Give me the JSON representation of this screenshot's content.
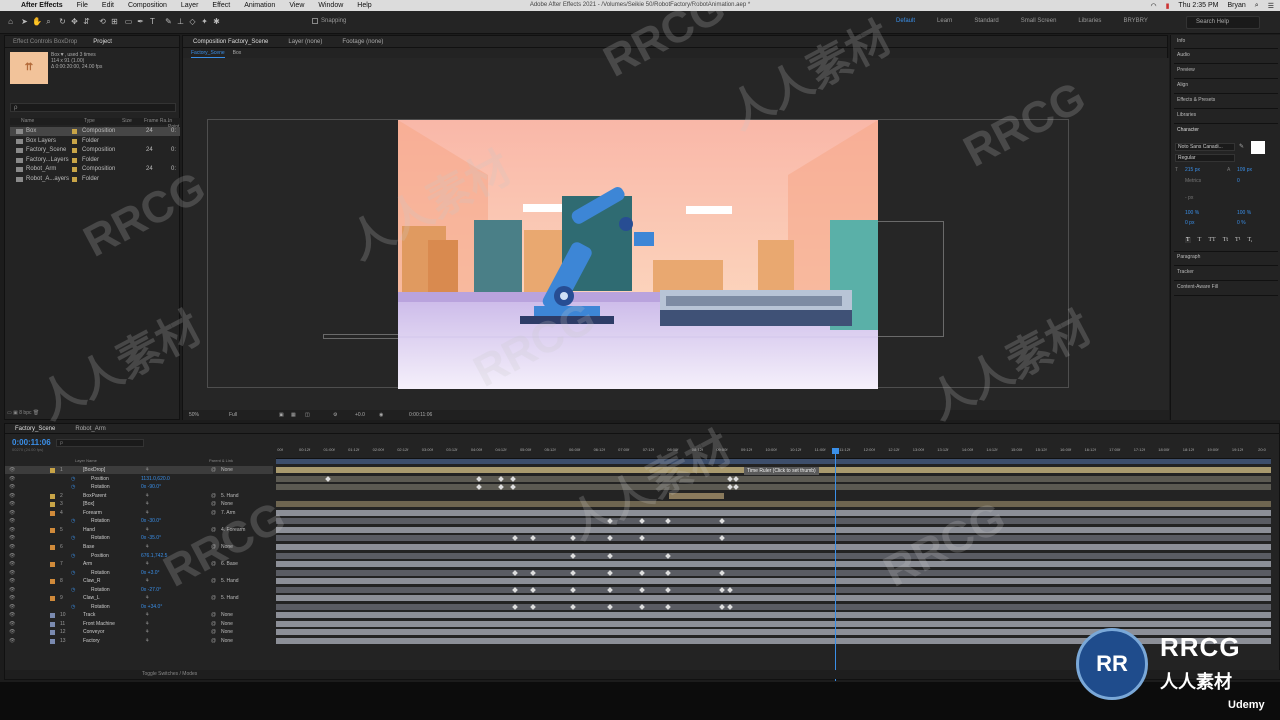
{
  "menubar": {
    "app": "After Effects",
    "items": [
      "File",
      "Edit",
      "Composition",
      "Layer",
      "Effect",
      "Animation",
      "View",
      "Window",
      "Help"
    ],
    "title": "Adobe After Effects 2021 - /Volumes/Seikie 50/RobotFactory/RobotAnimation.aep *",
    "clock": "Thu 2:35 PM",
    "user": "Bryan"
  },
  "toolbar": {
    "snapping": "Snapping",
    "workspaces": [
      "Default",
      "Learn",
      "Standard",
      "Small Screen",
      "Libraries",
      "BRYBRY"
    ],
    "search_help": "Search Help"
  },
  "project": {
    "tabs": [
      "Effect Controls BoxDrop",
      "Project"
    ],
    "thumb_name": "Box▼, used 3 times",
    "thumb_line2": "114 x 91 (1.00)",
    "thumb_line3": "Δ 0:00:20:00, 24.00 fps",
    "search_placeholder": "ρ",
    "columns": {
      "name": "Name",
      "type": "Type",
      "size": "Size",
      "fps": "Frame Ra...",
      "inpoint": "In Point"
    },
    "items": [
      {
        "name": "Box",
        "type": "Composition",
        "fps": "24",
        "in": "0:"
      },
      {
        "name": "Box Layers",
        "type": "Folder",
        "fps": "",
        "in": ""
      },
      {
        "name": "Factory_Scene",
        "type": "Composition",
        "fps": "24",
        "in": "0:"
      },
      {
        "name": "Factory...Layers",
        "type": "Folder",
        "fps": "",
        "in": ""
      },
      {
        "name": "Robot_Arm",
        "type": "Composition",
        "fps": "24",
        "in": "0:"
      },
      {
        "name": "Robot_A...ayers",
        "type": "Folder",
        "fps": "",
        "in": ""
      }
    ],
    "footer": "8 bpc"
  },
  "viewer": {
    "tabs": [
      "Composition Factory_Scene",
      "Layer (none)",
      "Footage (none)"
    ],
    "crumbs": [
      "Factory_Scene",
      "Box"
    ],
    "zoom": "50%",
    "resolution": "Full",
    "exposure": "+0.0",
    "time": "0:00:11:06"
  },
  "right": {
    "panels": [
      "Info",
      "Audio",
      "Preview",
      "Align",
      "Effects & Presets",
      "Libraries"
    ],
    "character_title": "Character",
    "font": "Noto Sans Canadi...",
    "style": "Regular",
    "size": "215 px",
    "leading": "109 px",
    "kerning": "Metrics",
    "tracking": "0",
    "stroke": "- px",
    "vscale": "100 %",
    "hscale": "100 %",
    "baseline": "0 px",
    "tsume": "0 %",
    "faux": [
      "T",
      "T",
      "TT",
      "Tt",
      "T¹",
      "T,"
    ],
    "lower_panels": [
      "Paragraph",
      "Tracker",
      "Content-Aware Fill"
    ]
  },
  "timeline": {
    "tabs": [
      "Factory_Scene",
      "Robot_Arm"
    ],
    "timecode": "0:00:11:06",
    "fps_info": "00270 (24.00 fps)",
    "search_placeholder": "ρ",
    "head": {
      "name": "Layer Name",
      "parent": "Parent & Link"
    },
    "ruler": [
      "00f",
      "00:12f",
      "01:00f",
      "01:12f",
      "02:00f",
      "02:12f",
      "03:00f",
      "03:12f",
      "04:00f",
      "04:12f",
      "05:00f",
      "05:12f",
      "06:00f",
      "06:12f",
      "07:00f",
      "07:12f",
      "08:00f",
      "08:12f",
      "09:00f",
      "09:12f",
      "10:00f",
      "10:12f",
      "11:00f",
      "11:12f",
      "12:00f",
      "12:12f",
      "13:00f",
      "13:12f",
      "14:00f",
      "14:12f",
      "15:00f",
      "15:12f",
      "16:00f",
      "16:12f",
      "17:00f",
      "17:12f",
      "18:00f",
      "18:12f",
      "19:00f",
      "19:12f",
      "20:0"
    ],
    "tooltip": "Time Ruler (Click to set thumb)",
    "rows": [
      {
        "kind": "layer",
        "idx": "1",
        "name": "[BoxDrop]",
        "parent": "None",
        "color": "#c8a447",
        "bar": [
          0,
          100
        ],
        "barColor": "#a99a6e",
        "keys": []
      },
      {
        "kind": "prop",
        "name": "Position",
        "value": "1131.0,620.0",
        "bar": [
          0,
          100
        ],
        "barColor": "#5c5a52",
        "keys": [
          5,
          20.2,
          22.4,
          23.6,
          45.4,
          46
        ]
      },
      {
        "kind": "prop",
        "name": "Rotation",
        "value": "0x -90.0°",
        "bar": [
          0,
          100
        ],
        "barColor": "#5c5a52",
        "keys": [
          20.2,
          22.4,
          23.6,
          45.4,
          46
        ]
      },
      {
        "kind": "layer",
        "idx": "2",
        "name": "BoxParent",
        "parent": "5. Hand",
        "color": "#c8a447",
        "bar": [
          39.5,
          45
        ],
        "barColor": "#8a7a5c",
        "keys": []
      },
      {
        "kind": "layer",
        "idx": "3",
        "name": "[Box]",
        "parent": "None",
        "color": "#c8a447",
        "bar": [
          0,
          100
        ],
        "barColor": "#6e6550",
        "keys": []
      },
      {
        "kind": "layer",
        "idx": "4",
        "name": "Forearm",
        "parent": "7. Arm",
        "color": "#d08a3a",
        "bar": [
          0,
          100
        ],
        "barColor": "#8c8f97",
        "keys": []
      },
      {
        "kind": "prop",
        "name": "Rotation",
        "value": "0x -30.0°",
        "bar": [
          0,
          100
        ],
        "barColor": "#5a5c63",
        "keys": [
          33.4,
          36.6,
          39.2,
          44.6
        ]
      },
      {
        "kind": "layer",
        "idx": "5",
        "name": "Hand",
        "parent": "4. Forearm",
        "color": "#d08a3a",
        "bar": [
          0,
          100
        ],
        "barColor": "#8c8f97",
        "keys": []
      },
      {
        "kind": "prop",
        "name": "Rotation",
        "value": "0x -35.0°",
        "bar": [
          0,
          100
        ],
        "barColor": "#5a5c63",
        "keys": [
          23.8,
          25.6,
          29.6,
          33.4,
          36.6,
          44.6
        ]
      },
      {
        "kind": "layer",
        "idx": "6",
        "name": "Base",
        "parent": "None",
        "color": "#d08a3a",
        "bar": [
          0,
          100
        ],
        "barColor": "#8c8f97",
        "keys": []
      },
      {
        "kind": "prop",
        "name": "Position",
        "value": "676.1,742.5",
        "bar": [
          0,
          100
        ],
        "barColor": "#5a5c63",
        "keys": [
          29.6,
          33.4,
          39.2
        ]
      },
      {
        "kind": "layer",
        "idx": "7",
        "name": "Arm",
        "parent": "6. Base",
        "color": "#d08a3a",
        "bar": [
          0,
          100
        ],
        "barColor": "#8c8f97",
        "keys": []
      },
      {
        "kind": "prop",
        "name": "Rotation",
        "value": "0x +3.0°",
        "bar": [
          0,
          100
        ],
        "barColor": "#5a5c63",
        "keys": [
          23.8,
          25.6,
          29.6,
          33.4,
          36.6,
          39.2,
          44.6
        ]
      },
      {
        "kind": "layer",
        "idx": "8",
        "name": "Claw_R",
        "parent": "5. Hand",
        "color": "#d08a3a",
        "bar": [
          0,
          100
        ],
        "barColor": "#8c8f97",
        "keys": []
      },
      {
        "kind": "prop",
        "name": "Rotation",
        "value": "0x -27.0°",
        "bar": [
          0,
          100
        ],
        "barColor": "#5a5c63",
        "keys": [
          23.8,
          25.6,
          29.6,
          33.4,
          36.6,
          39.2,
          44.6,
          45.4
        ]
      },
      {
        "kind": "layer",
        "idx": "9",
        "name": "Claw_L",
        "parent": "5. Hand",
        "color": "#d08a3a",
        "bar": [
          0,
          100
        ],
        "barColor": "#8c8f97",
        "keys": []
      },
      {
        "kind": "prop",
        "name": "Rotation",
        "value": "0x +34.0°",
        "bar": [
          0,
          100
        ],
        "barColor": "#5a5c63",
        "keys": [
          23.8,
          25.6,
          29.6,
          33.4,
          36.6,
          39.2,
          44.6,
          45.4
        ]
      },
      {
        "kind": "layer",
        "idx": "10",
        "name": "Track",
        "parent": "None",
        "color": "#7a8ab0",
        "bar": [
          0,
          100
        ],
        "barColor": "#8c8f97",
        "keys": []
      },
      {
        "kind": "layer",
        "idx": "11",
        "name": "Front Machine",
        "parent": "None",
        "color": "#7a8ab0",
        "bar": [
          0,
          100
        ],
        "barColor": "#8c8f97",
        "keys": []
      },
      {
        "kind": "layer",
        "idx": "12",
        "name": "Conveyor",
        "parent": "None",
        "color": "#7a8ab0",
        "bar": [
          0,
          100
        ],
        "barColor": "#8c8f97",
        "keys": []
      },
      {
        "kind": "layer",
        "idx": "13",
        "name": "Factory",
        "parent": "None",
        "color": "#7a8ab0",
        "bar": [
          0,
          100
        ],
        "barColor": "#8c8f97",
        "keys": []
      }
    ],
    "cti_percent": 56.2,
    "toggle": "Toggle Switches / Modes"
  },
  "brand": {
    "watermark": "RRCG",
    "watermark_cn": "人人素材",
    "logo_letters": "RR",
    "udemy": "Udemy"
  }
}
